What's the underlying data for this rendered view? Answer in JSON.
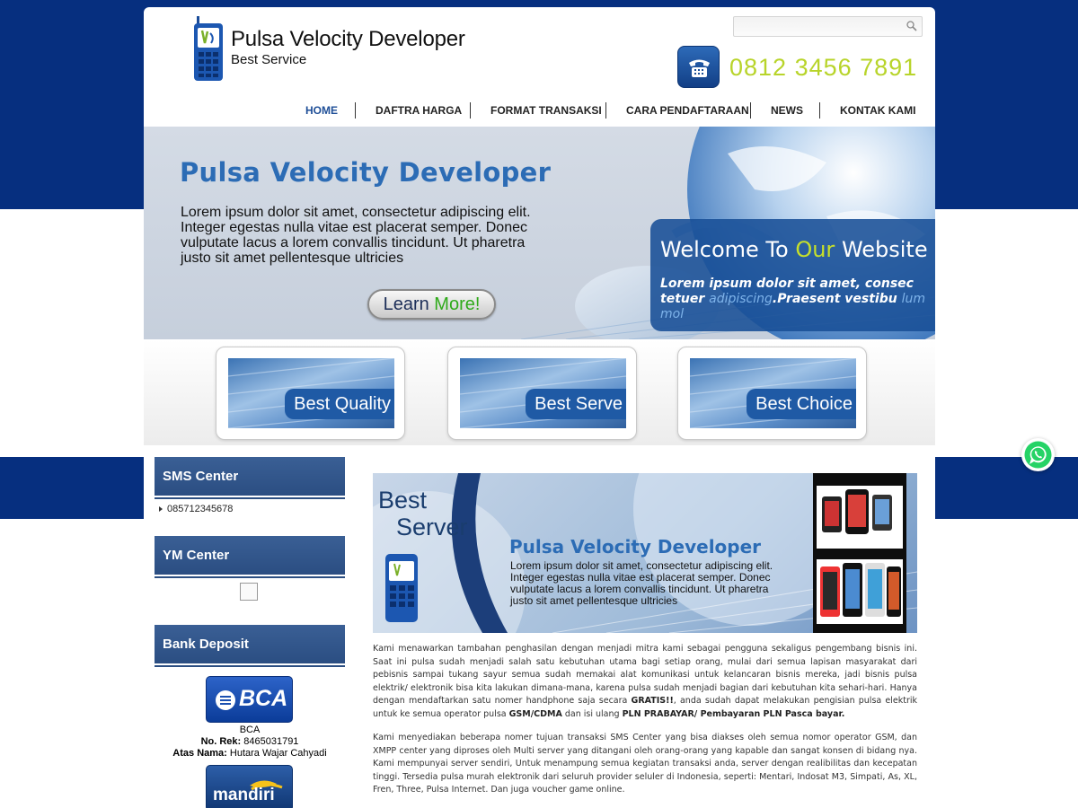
{
  "header": {
    "brand_name": "Pulsa Velocity Developer",
    "tagline": "Best Service",
    "phone_number": "0812 3456 7891",
    "search_value": ""
  },
  "nav": {
    "items": [
      {
        "label": "HOME",
        "active": true
      },
      {
        "label": "DAFTRA HARGA",
        "active": false
      },
      {
        "label": "FORMAT TRANSAKSI",
        "active": false
      },
      {
        "label": "CARA PENDAFTARAAN",
        "active": false
      },
      {
        "label": "NEWS",
        "active": false
      },
      {
        "label": "KONTAK KAMI",
        "active": false
      }
    ]
  },
  "hero": {
    "title": "Pulsa Velocity Developer",
    "text": "Lorem ipsum dolor sit amet, consectetur adipiscing elit. Integer egestas nulla vitae est placerat semper. Donec vulputate lacus a lorem convallis tincidunt. Ut pharetra justo sit amet pellentesque ultricies",
    "button_part1": "Learn",
    "button_part2": "More!",
    "welcome_a": "Welcome To",
    "welcome_hl": "Our",
    "welcome_b": "Website",
    "welcome_sub_a": "Lorem ipsum dolor sit amet, consec tetuer",
    "welcome_sub_dim1": "adipiscing",
    "welcome_sub_b": ".Praesent vestibu",
    "welcome_sub_dim2": "lum mol"
  },
  "features": [
    {
      "label": "Best Quality"
    },
    {
      "label": "Best Serve"
    },
    {
      "label": "Best Choice"
    }
  ],
  "sidebar": {
    "sms_title": "SMS Center",
    "sms_number": "085712345678",
    "ym_title": "YM Center",
    "bank_title": "Bank Deposit",
    "bca": {
      "logo_text": "BCA",
      "name": "BCA",
      "rek_label": "No. Rek:",
      "rek_value": "8465031791",
      "nama_label": "Atas Nama:",
      "nama_value": "Hutara Wajar Cahyadi"
    },
    "mandiri": {
      "logo_text": "mandiri"
    }
  },
  "main": {
    "banner_best": "Best",
    "banner_server": "Server",
    "banner_title": "Pulsa Velocity Developer",
    "banner_text": "Lorem ipsum dolor sit amet, consectetur adipiscing elit. Integer egestas nulla vitae est placerat semper. Donec vulputate lacus a lorem convallis tincidunt. Ut pharetra justo sit amet pellentesque ultricies",
    "p1_a": "Kami menawarkan tambahan penghasilan dengan menjadi mitra kami sebagai pengguna sekaligus pengembang bisnis ini. Saat ini pulsa sudah menjadi salah satu kebutuhan utama bagi setiap orang, mulai dari semua lapisan masyarakat dari pebisnis sampai tukang sayur semua sudah memakai alat komunikasi untuk kelancaran bisnis mereka, jadi bisnis pulsa elektrik/ elektronik bisa kita lakukan dimana-mana, karena pulsa sudah menjadi bagian dari kebutuhan kita sehari-hari. Hanya dengan mendaftarkan satu nomer handphone saja secara ",
    "p1_b1": "GRATIS!!",
    "p1_c": ", anda sudah dapat melakukan pengisian pulsa elektrik untuk ke semua operator pulsa ",
    "p1_b2": "GSM/CDMA",
    "p1_d": " dan isi ulang ",
    "p1_b3": "PLN PRABAYAR/ Pembayaran PLN Pasca bayar.",
    "p2": "Kami menyediakan beberapa nomer tujuan transaksi SMS Center yang bisa diakses oleh semua nomor operator GSM, dan XMPP center yang diproses oleh Multi server yang ditangani oleh orang-orang yang kapable dan sangat konsen di bidang nya. Kami mempunyai server sendiri, Untuk menampung semua kegiatan transaksi anda, server dengan realibilitas dan kecepatan tinggi. Tersedia pulsa murah elektronik dari seluruh provider seluler di Indonesia, seperti: Mentari, Indosat M3, Simpati, As, XL, Fren, Three, Pulsa Internet. Dan juga voucher game online."
  },
  "colors": {
    "navy_band": "#062f7f",
    "hotline": "#b8d42a",
    "accent_blue": "#2c6cb5",
    "whatsapp": "#25d366"
  }
}
